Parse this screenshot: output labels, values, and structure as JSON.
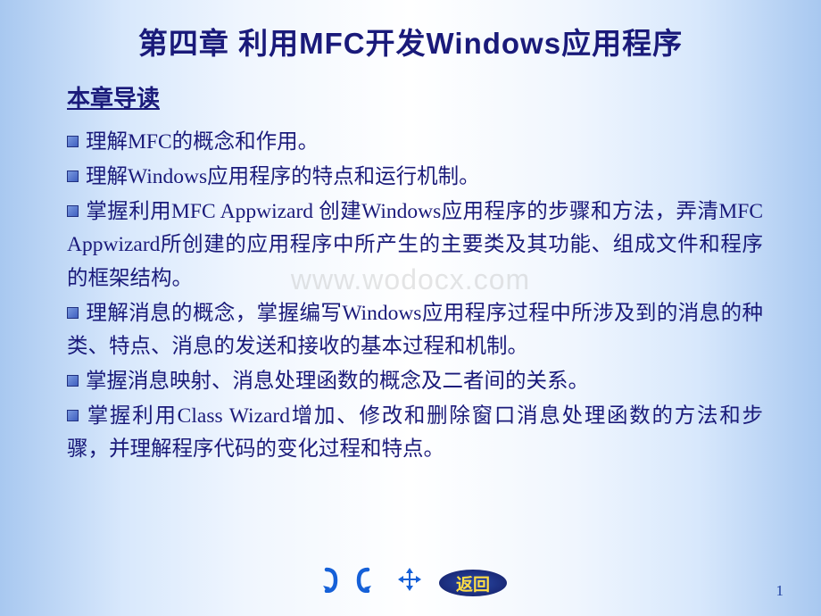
{
  "title": "第四章 利用MFC开发Windows应用程序",
  "subtitle": "本章导读",
  "watermark": "www.wodocx.com",
  "bullets": [
    "理解MFC的概念和作用。",
    "理解Windows应用程序的特点和运行机制。",
    "掌握利用MFC Appwizard 创建Windows应用程序的步骤和方法，弄清MFC Appwizard所创建的应用程序中所产生的主要类及其功能、组成文件和程序的框架结构。",
    "理解消息的概念，掌握编写Windows应用程序过程中所涉及到的消息的种类、特点、消息的发送和接收的基本过程和机制。",
    "掌握消息映射、消息处理函数的概念及二者间的关系。",
    "掌握利用Class Wizard增加、修改和删除窗口消息处理函数的方法和步骤，并理解程序代码的变化过程和特点。"
  ],
  "nav": {
    "back_label": "返回"
  },
  "page_number": "1"
}
